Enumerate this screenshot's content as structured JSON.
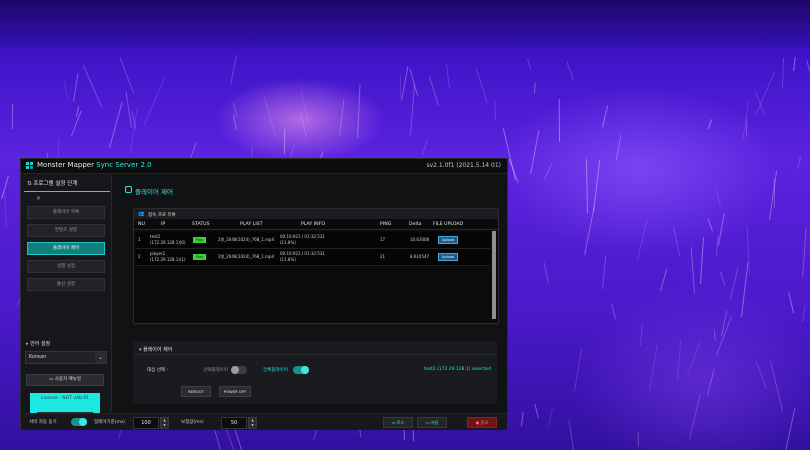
{
  "app": {
    "title": "Monster Mapper",
    "title_sync": "Sync Server 2.0",
    "version": "sv2.1.0f1 (2021.5.14 01)"
  },
  "sidebar": {
    "header": "프로그램 설정 단계",
    "close_glyph": "✕",
    "items": [
      {
        "label": "플레이어 목록",
        "active": false
      },
      {
        "label": "컨텐츠 설정",
        "active": false
      },
      {
        "label": "플레이어 제어",
        "active": true
      },
      {
        "label": "실행 설정",
        "active": false
      },
      {
        "label": "통신 설정",
        "active": false
      }
    ],
    "language_header": "언어 설정",
    "language_value": "Korean",
    "manual_button": "사용자 매뉴얼",
    "license_text": "License - NOT vAb.01",
    "license_button": "라이센스 등록"
  },
  "main": {
    "title": "플레이어 제어",
    "list_title": "접속 프로 목록",
    "columns": [
      "NU",
      "IP",
      "STATUS",
      "PLAY LIST",
      "PLAY INFO",
      "PING",
      "Delta",
      "FILE UPLOAD"
    ],
    "rows": [
      {
        "nu": "1",
        "name": "test2",
        "ip": "(172.29.128.1)(0)",
        "status": "Play",
        "playlist": "2병_2048(1024)_768_1.mp4",
        "info1": "00:10:921 / 01:32:531",
        "info2": "(11.8%)",
        "ping": "17",
        "delta": "10.63008",
        "upload": "Upload"
      },
      {
        "nu": "2",
        "name": "player2",
        "ip": "(172.29.128.1)(1)",
        "status": "Play",
        "playlist": "2병_2048(1024)_768_1.mp4",
        "info1": "00:10:921 / 01:32:531",
        "info2": "(11.8%)",
        "ping": "21",
        "delta": "8.610547",
        "upload": "Upload"
      }
    ]
  },
  "control": {
    "header": "플레이어 제어",
    "target_label": "대상 선택 :",
    "select_player_label": "선택플레이어",
    "select_player_on": false,
    "all_players_label": "전체플레이어",
    "all_players_on": true,
    "selected_text": "test2 (172.29.128.1) selected",
    "reboot_button": "REBOOT",
    "poweroff_button": "POWER OFF"
  },
  "bottom": {
    "server_sync_label": "서버 자동 동기",
    "server_sync_on": true,
    "interval_label": "딜레이기준(ms)",
    "interval_value": "100",
    "offset_label": "보정값(ms)",
    "offset_value": "50",
    "load_button": "로드",
    "save_button": "저장",
    "exit_button": "종료"
  },
  "colors": {
    "accent": "#2ee6e0",
    "status_play": "#32d732",
    "exit_button": "#7a1414",
    "background_glow": "#5b23df"
  }
}
